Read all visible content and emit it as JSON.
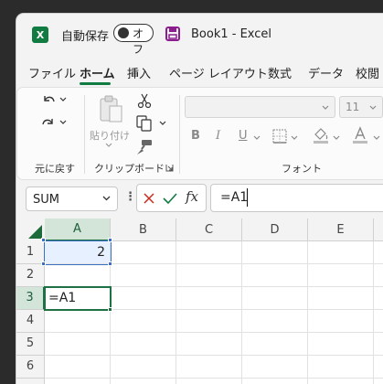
{
  "app": {
    "logo": "X",
    "autosave_label": "自動保存",
    "autosave_state": "オフ",
    "doc_title": "Book1  -  Excel"
  },
  "tabs": [
    {
      "label": "ファイル",
      "active": false
    },
    {
      "label": "ホーム",
      "active": true
    },
    {
      "label": "挿入",
      "active": false
    },
    {
      "label": "ページ レイアウト",
      "active": false
    },
    {
      "label": "数式",
      "active": false
    },
    {
      "label": "データ",
      "active": false
    },
    {
      "label": "校閲",
      "active": false
    }
  ],
  "ribbon": {
    "undo_group_label": "元に戻す",
    "clipboard_group_label": "クリップボード",
    "paste_label": "貼り付け",
    "font_group_label": "フォント",
    "font_name": "",
    "font_size": "11",
    "bold": "B",
    "italic": "I",
    "underline": "U"
  },
  "formula_bar": {
    "name_box": "SUM",
    "fx": "fx",
    "content": "=A1"
  },
  "grid": {
    "columns": [
      "A",
      "B",
      "C",
      "D",
      "E"
    ],
    "rows": [
      "1",
      "2",
      "3",
      "4",
      "5",
      "6"
    ],
    "selected_column": "A",
    "active_row": "3",
    "cells": {
      "A1": "2",
      "A3": "=A1"
    }
  },
  "colors": {
    "excel_green": "#107c41",
    "selection_border": "#1e7145",
    "reference_border": "#3b6fc4",
    "reference_fill": "#e7f0ff",
    "cancel_red": "#c42b1c",
    "enter_green": "#107c41"
  },
  "icons": {
    "logo": "excel-logo-icon",
    "save": "save-icon",
    "undo": "undo-icon",
    "redo": "redo-icon",
    "paste": "paste-icon",
    "cut": "scissors-icon",
    "copy": "copy-icon",
    "format_painter": "format-painter-icon",
    "borders": "borders-icon",
    "fill_color": "fill-color-icon",
    "font_color": "font-color-icon",
    "cancel": "close-icon",
    "enter": "check-icon",
    "dialog_launcher": "dialog-launcher-icon"
  }
}
